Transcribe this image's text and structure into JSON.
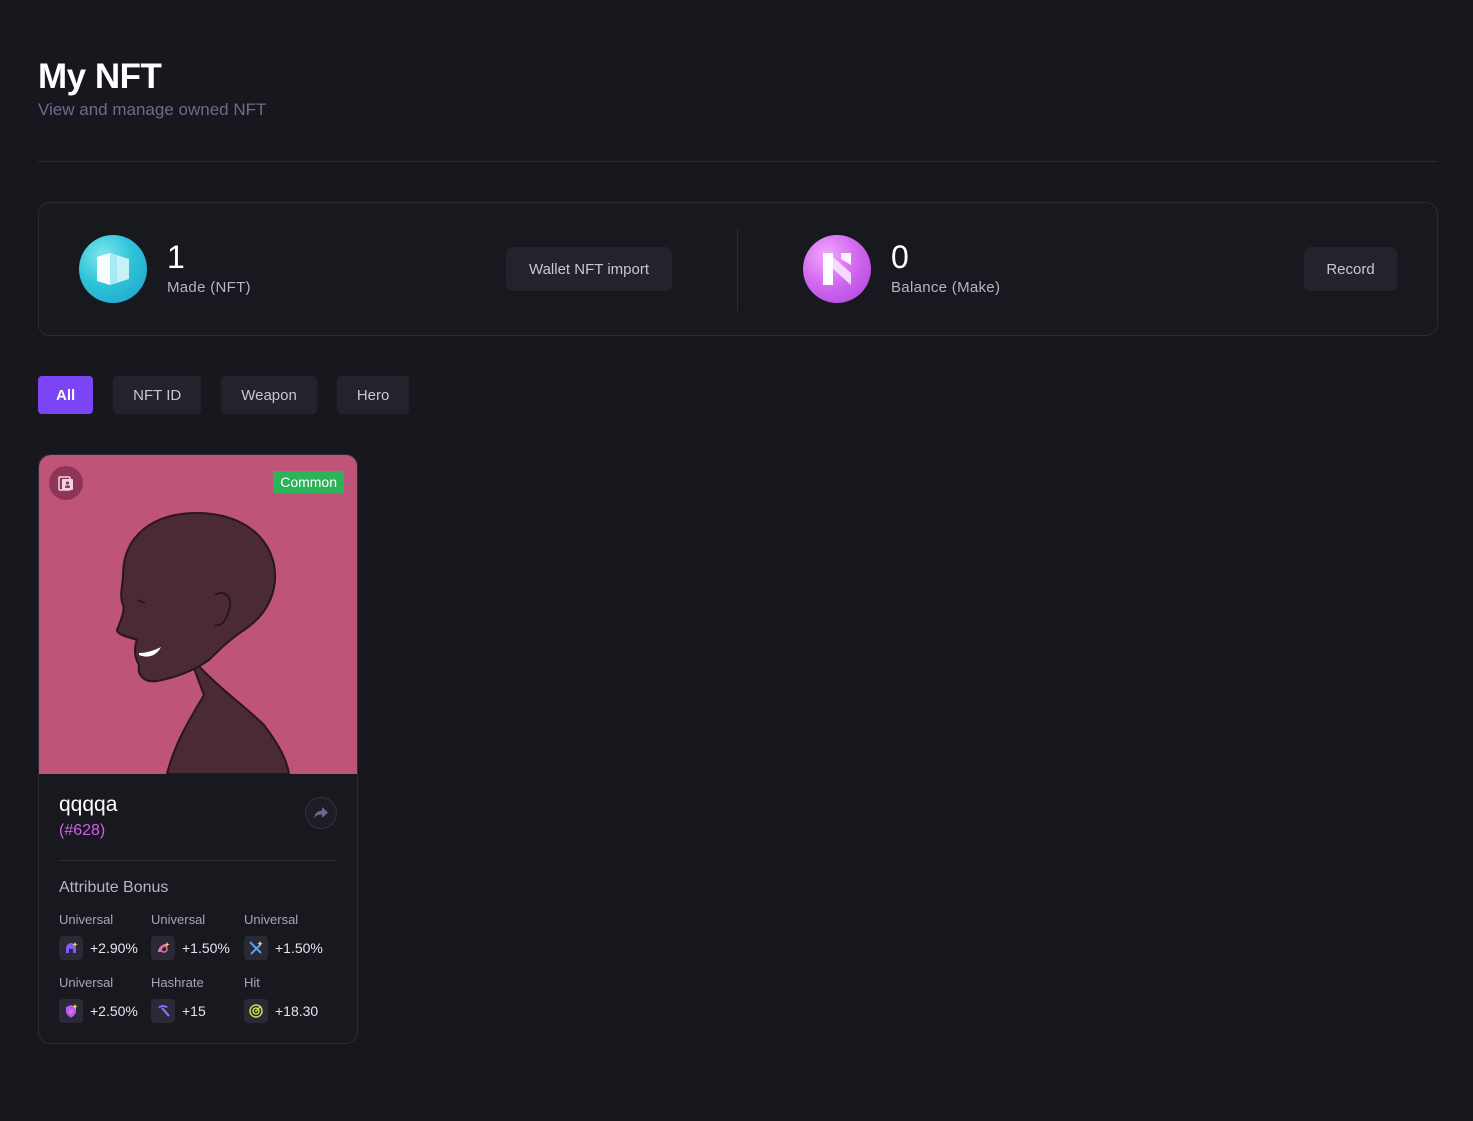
{
  "header": {
    "title": "My NFT",
    "subtitle": "View and manage owned NFT"
  },
  "stats": {
    "nft": {
      "value": "1",
      "label": "Made (NFT)",
      "button": "Wallet NFT import",
      "icon": "make-nft-coin-icon"
    },
    "make": {
      "value": "0",
      "label": "Balance (Make)",
      "button": "Record",
      "icon": "make-token-coin-icon"
    }
  },
  "tabs": [
    {
      "label": "All",
      "active": true
    },
    {
      "label": "NFT ID",
      "active": false
    },
    {
      "label": "Weapon",
      "active": false
    },
    {
      "label": "Hero",
      "active": false
    }
  ],
  "cards": [
    {
      "name": "qqqqa",
      "id": "(#628)",
      "rarity": "Common",
      "rarity_color": "#2bb35a",
      "image_bg": "#be5477",
      "attributes_title": "Attribute Bonus",
      "attributes": [
        {
          "label": "Universal",
          "value": "+2.90%",
          "icon": "helmet-icon"
        },
        {
          "label": "Universal",
          "value": "+1.50%",
          "icon": "boot-icon"
        },
        {
          "label": "Universal",
          "value": "+1.50%",
          "icon": "crossed-swords-icon"
        },
        {
          "label": "Universal",
          "value": "+2.50%",
          "icon": "shield-heart-icon"
        },
        {
          "label": "Hashrate",
          "value": "+15",
          "icon": "pickaxe-icon"
        },
        {
          "label": "Hit",
          "value": "+18.30",
          "icon": "target-icon"
        }
      ]
    }
  ],
  "colors": {
    "background": "#17171d",
    "accent": "#7b44f5",
    "id_purple": "#d25dea",
    "muted_text": "#6f6a90"
  }
}
